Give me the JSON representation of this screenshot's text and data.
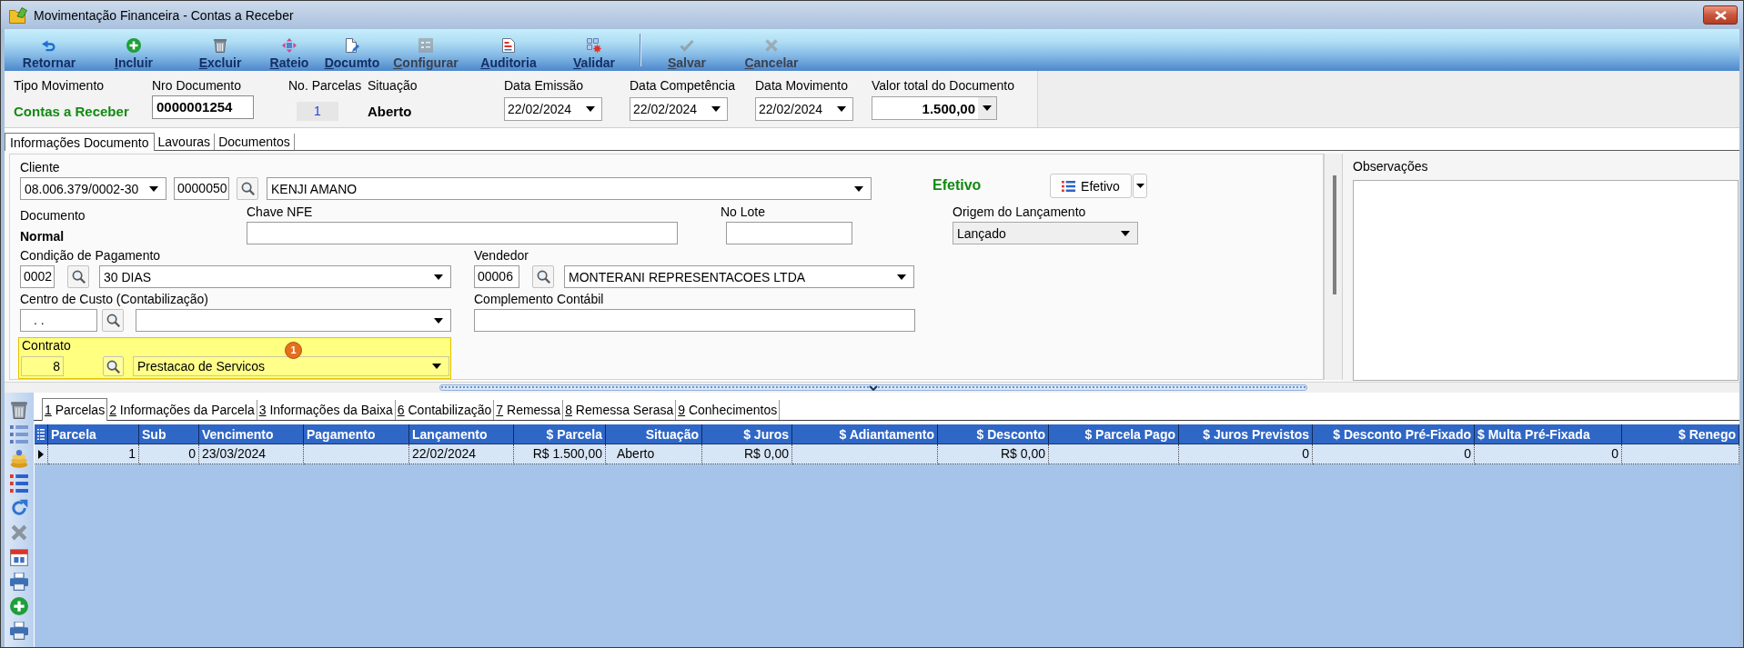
{
  "window": {
    "title": "Movimentação Financeira - Contas a Receber"
  },
  "toolbar": [
    {
      "label": "Retornar",
      "disabled": false,
      "accelerator": false
    },
    {
      "label": "Incluir",
      "disabled": false,
      "accelerator": true
    },
    {
      "label": "Excluir",
      "disabled": false,
      "accelerator": true
    },
    {
      "label": "Rateio",
      "disabled": false,
      "accelerator": true
    },
    {
      "label": "Documto",
      "disabled": false,
      "accelerator": true
    },
    {
      "label": "Configurar",
      "disabled": true,
      "accelerator": true
    },
    {
      "label": "Auditoria",
      "disabled": false,
      "accelerator": true
    },
    {
      "label": "Validar",
      "disabled": false,
      "accelerator": true
    },
    {
      "label": "Salvar",
      "disabled": true,
      "accelerator": true
    },
    {
      "label": "Cancelar",
      "disabled": true,
      "accelerator": true
    }
  ],
  "header": [
    {
      "label": "Tipo Movimento",
      "value": "Contas a Receber",
      "kind": "accent"
    },
    {
      "label": "Nro Documento",
      "value": "0000001254",
      "kind": "input"
    },
    {
      "label": "No. Parcelas",
      "value": "1",
      "kind": "count"
    },
    {
      "label": "Situação",
      "value": "Aberto",
      "kind": "text"
    },
    {
      "label": "Data Emissão",
      "value": "22/02/2024",
      "kind": "date"
    },
    {
      "label": "Data Competência",
      "value": "22/02/2024",
      "kind": "date"
    },
    {
      "label": "Data Movimento",
      "value": "22/02/2024",
      "kind": "date"
    },
    {
      "label": "Valor total do Documento",
      "value": "1.500,00",
      "kind": "amount"
    }
  ],
  "form_tabs": [
    {
      "label": "Informações Documento",
      "selected": true
    },
    {
      "label": "Lavouras",
      "selected": false
    },
    {
      "label": "Documentos",
      "selected": false
    }
  ],
  "form": {
    "cliente": {
      "label": "Cliente",
      "document": "08.006.379/0002-30",
      "code": "0000050",
      "name": "KENJI AMANO"
    },
    "status": {
      "text": "Efetivo",
      "button": "Efetivo"
    },
    "documento": {
      "label": "Documento",
      "value": "Normal"
    },
    "chave_nfe": {
      "label": "Chave NFE"
    },
    "no_lote": {
      "label": "No Lote"
    },
    "origem": {
      "label": "Origem do Lançamento",
      "value": "Lançado"
    },
    "condicao_pagamento": {
      "label": "Condição de Pagamento",
      "code": "0002",
      "name": "30 DIAS"
    },
    "vendedor": {
      "label": "Vendedor",
      "code": "00006",
      "name": "MONTERANI REPRESENTACOES LTDA"
    },
    "centro_custo": {
      "label": "Centro de Custo (Contabilização)",
      "code": ". ."
    },
    "complemento": {
      "label": "Complemento Contábil"
    },
    "contrato": {
      "label": "Contrato",
      "code": "8",
      "name": "Prestacao de Servicos",
      "highlighted": true,
      "badge": "1"
    }
  },
  "observacoes": {
    "label": "Observações"
  },
  "detail_tabs": [
    {
      "label": "1 Parcelas",
      "selected": true
    },
    {
      "label": "2 Informações da Parcela",
      "selected": false
    },
    {
      "label": "3 Informações da Baixa",
      "selected": false
    },
    {
      "label": "6 Contabilização",
      "selected": false
    },
    {
      "label": "7 Remessa",
      "selected": false
    },
    {
      "label": "8 Remessa Serasa",
      "selected": false
    },
    {
      "label": "9 Conhecimentos",
      "selected": false
    }
  ],
  "table": {
    "columns": [
      "Parcela",
      "Sub",
      "Vencimento",
      "Pagamento",
      "Lançamento",
      "$ Parcela",
      "Situação",
      "$ Juros",
      "$ Adiantamento",
      "$ Desconto",
      "$ Parcela Pago",
      "$ Juros Previstos",
      "$ Desconto Pré-Fixado",
      "$ Multa Pré-Fixada",
      "$ Renego"
    ],
    "rows": [
      {
        "selected": true,
        "cells": [
          "1",
          "0",
          "23/03/2024",
          null,
          "22/02/2024",
          "R$ 1.500,00",
          "Aberto",
          "R$ 0,00",
          null,
          "R$ 0,00",
          null,
          "0",
          "0",
          "0",
          null
        ]
      }
    ]
  }
}
